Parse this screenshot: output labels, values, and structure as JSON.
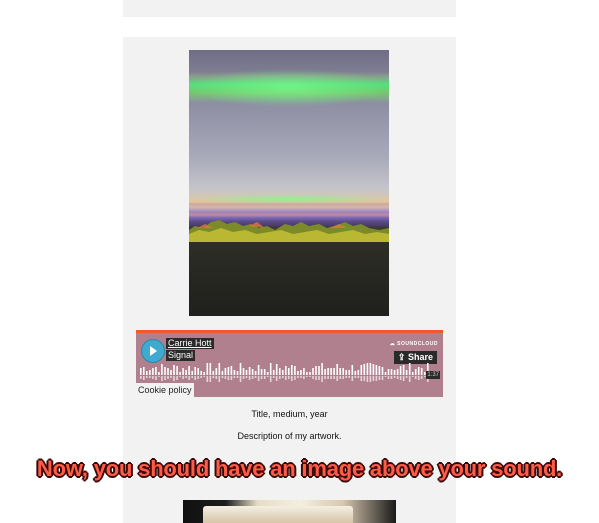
{
  "player": {
    "artist": "Carrie Hott",
    "track": "Signal",
    "brand": "SOUNDCLOUD",
    "share_label": "Share",
    "share_icon": "share-icon",
    "duration": "1:37",
    "accent_color": "#f1582e"
  },
  "cookie_label": "Cookie policy",
  "caption": {
    "title": "Title, medium, year",
    "description": "Description of my artwork."
  },
  "overlay_text": "Now, you should have an image above your sound."
}
